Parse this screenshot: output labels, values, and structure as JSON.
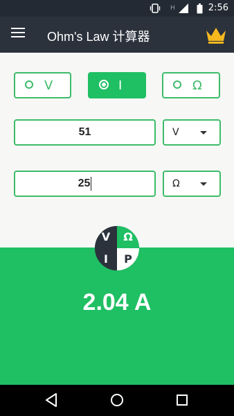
{
  "status_bar": {
    "time": "2:56"
  },
  "app_bar": {
    "title": "Ohm's Law 计算器"
  },
  "mode_selector": [
    {
      "label": "V",
      "selected": false
    },
    {
      "label": "I",
      "selected": true
    },
    {
      "label": "Ω",
      "selected": false
    }
  ],
  "inputs": {
    "voltage": {
      "value": "51",
      "unit": "V"
    },
    "resistance": {
      "value": "25",
      "unit": "Ω"
    }
  },
  "logo": {
    "v": "V",
    "omega": "Ω",
    "i": "I",
    "p": "P"
  },
  "result": {
    "value": "2.04 A"
  },
  "colors": {
    "accent": "#1fbf63",
    "app_bar": "#2b323c",
    "status_bar": "#232a33",
    "crown": "#f5b91e"
  }
}
